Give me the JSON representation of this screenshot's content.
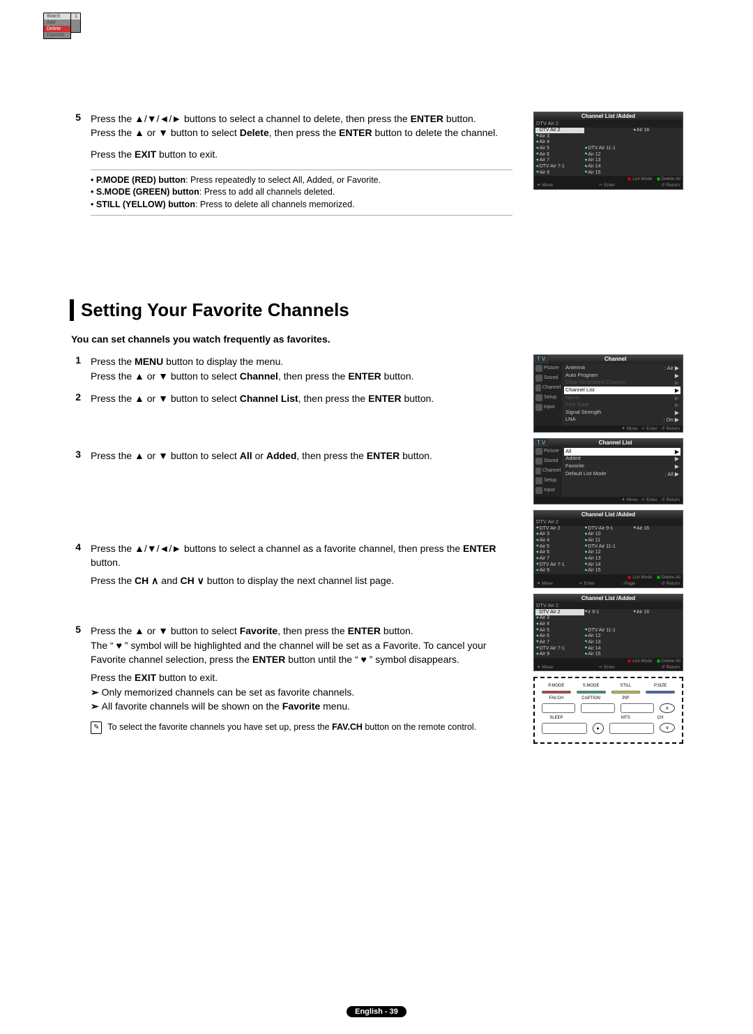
{
  "top_step": {
    "num": "5",
    "p1_a": "Press the ▲/▼/◄/► buttons to select a channel to delete, then press the ",
    "p1_b": "ENTER",
    "p1_c": " button.",
    "p2_a": "Press the ▲ or ▼ button to select ",
    "p2_b": "Delete",
    "p2_c": ", then press the ",
    "p2_d": "ENTER",
    "p2_e": " button to delete the channel.",
    "p3_a": "Press the ",
    "p3_b": "EXIT",
    "p3_c": " button to exit.",
    "bullets": [
      {
        "b": "P.MODE (RED) button",
        "t": ": Press repeatedly to select All, Added, or Favorite."
      },
      {
        "b": "S.MODE (GREEN) button",
        "t": ": Press to add all channels deleted."
      },
      {
        "b": "STILL (YELLOW) button",
        "t": ": Press to delete all channels memorized."
      }
    ]
  },
  "heading": "Setting Your Favorite Channels",
  "intro": "You can set channels you watch frequently as favorites.",
  "steps": [
    {
      "num": "1",
      "lines": [
        {
          "parts": [
            "Press the ",
            "MENU",
            " button to display the menu."
          ]
        },
        {
          "parts": [
            "Press the ▲ or ▼ button to select ",
            "Channel",
            ", then press the ",
            "ENTER",
            " button."
          ]
        }
      ]
    },
    {
      "num": "2",
      "lines": [
        {
          "parts": [
            "Press the ▲ or ▼ button to select ",
            "Channel List",
            ", then press the ",
            "ENTER",
            " button."
          ]
        }
      ]
    },
    {
      "num": "3",
      "lines": [
        {
          "parts": [
            "Press the ▲ or ▼ button to select ",
            "All",
            " or ",
            "Added",
            ", then press the ",
            "ENTER",
            " button."
          ]
        }
      ]
    },
    {
      "num": "4",
      "lines": [
        {
          "parts": [
            "Press the ▲/▼/◄/► buttons to select a channel as a favorite channel, then press the ",
            "ENTER",
            " button."
          ]
        },
        {
          "parts": [
            "Press the ",
            "CH ∧",
            " and ",
            "CH ∨",
            " button to display the next channel list page."
          ]
        }
      ]
    },
    {
      "num": "5",
      "lines": [
        {
          "parts": [
            "Press the ▲ or ▼ button to select ",
            "Favorite",
            ", then press the ",
            "ENTER",
            " button."
          ]
        },
        {
          "plain": "The “ ♥ ” symbol will be highlighted and the channel will be set as a Favorite. To cancel your Favorite channel selection, press the ENTER button until the “ ♥ ” symbol disappears.",
          "boldparts": [
            "ENTER"
          ]
        },
        {
          "parts": [
            "Press the ",
            "EXIT",
            " button to exit."
          ]
        }
      ],
      "arrows": [
        "Only memorized channels can be set as favorite channels.",
        "All favorite channels will be shown on the Favorite menu."
      ]
    }
  ],
  "infonote_a": "To select the favorite channels you have set up, press the ",
  "infonote_b": "FAV.CH",
  "infonote_c": " button on the remote control.",
  "osd1": {
    "title": "Channel List /Added",
    "sub": "DTV Air 2",
    "col1": [
      "DTV Air 2",
      "Air 3",
      "Air 4",
      "Air 5",
      "Air 6",
      "Air 7",
      "DTV Air 7-1",
      "Air 9"
    ],
    "popup": [
      "Watch",
      "Add",
      "Favorite"
    ],
    "popnum": "1",
    "col2": [
      "",
      "",
      "",
      "DTV Air 11-1",
      "Air 12",
      "Air 13",
      "Air 14",
      "Air 15"
    ],
    "col3": [
      "Air 16",
      "",
      "",
      "",
      "",
      "",
      "",
      ""
    ],
    "foot_l": "List Mode",
    "foot_r": "Delete All",
    "bar": {
      "move": "Move",
      "enter": "Enter",
      "ret": "Return"
    }
  },
  "osd2": {
    "tv": "T V",
    "title": "Channel",
    "side": [
      "Picture",
      "Sound",
      "Channel",
      "Setup",
      "Input"
    ],
    "rows": [
      {
        "l": "Antenna",
        "r": ": Air",
        "on": true
      },
      {
        "l": "Auto Program",
        "r": "",
        "on": true
      },
      {
        "l": "Clear Scrambled Channel",
        "r": "",
        "on": false
      },
      {
        "l": "Channel List",
        "r": "",
        "on": true,
        "hl": true
      },
      {
        "l": "Name",
        "r": "",
        "on": false
      },
      {
        "l": "Fine Tune",
        "r": "",
        "on": false
      },
      {
        "l": "Signal Strength",
        "r": "",
        "on": true
      },
      {
        "l": "LNA",
        "r": ": On",
        "on": true
      }
    ],
    "bar": {
      "move": "Move",
      "enter": "Enter",
      "ret": "Return"
    }
  },
  "osd3": {
    "tv": "T V",
    "title": "Channel List",
    "side": [
      "Picture",
      "Sound",
      "Channel",
      "Setup",
      "Input"
    ],
    "rows": [
      {
        "l": "All",
        "hl": true
      },
      {
        "l": "Added"
      },
      {
        "l": "Favorite"
      },
      {
        "l": "Default List Mode",
        "r": ": All"
      }
    ],
    "bar": {
      "move": "Move",
      "enter": "Enter",
      "ret": "Return"
    }
  },
  "osd4": {
    "title": "Channel List /Added",
    "sub": "DTV Air 2",
    "col1": [
      "DTV Air 2",
      "Air 3",
      "Air 4",
      "Air 5",
      "Air 6",
      "Air 7",
      "DTV Air 7-1",
      "Air 9"
    ],
    "col2": [
      "DTV Air 9-1",
      "Air 10",
      "Air 11",
      "DTV Air 11-1",
      "Air 12",
      "Air 13",
      "Air 14",
      "Air 15"
    ],
    "col3": [
      "Air 16",
      "",
      "",
      "",
      "",
      "",
      "",
      ""
    ],
    "foot_l": "List Mode",
    "foot_r": "Delete All",
    "bar": {
      "move": "Move",
      "enter": "Enter",
      "page": "Page",
      "ret": "Return"
    }
  },
  "osd5": {
    "title": "Channel List /Added",
    "sub": "DTV Air 2",
    "col1": [
      "DTV Air 2",
      "Air 3",
      "Air 4",
      "Air 5",
      "Air 6",
      "Air 7",
      "DTV Air 7-1",
      "Air 9"
    ],
    "popup": [
      "Watch",
      "Add",
      "Delete",
      "Favorite"
    ],
    "hidecol2top": "ir 9-1",
    "col2": [
      "",
      "",
      "",
      "DTV Air 11-1",
      "Air 12",
      "Air 13",
      "Air 14",
      "Air 15"
    ],
    "col3": [
      "Air 16",
      "",
      "",
      "",
      "",
      "",
      "",
      ""
    ],
    "foot_l": "List Mode",
    "foot_r": "Delete All",
    "bar": {
      "move": "Move",
      "enter": "Enter",
      "ret": "Return"
    }
  },
  "remote": {
    "r1": [
      "P.MODE",
      "S.MODE",
      "STILL",
      "P.SIZE"
    ],
    "r2": [
      "FAV.CH",
      "CAPTION",
      "PIP",
      ""
    ],
    "r3": [
      "SLEEP",
      "",
      "MTS",
      ""
    ],
    "ch_up": "∧",
    "ch_dn": "∨",
    "ch": "CH",
    "rec": "●"
  },
  "footer": "English - 39"
}
